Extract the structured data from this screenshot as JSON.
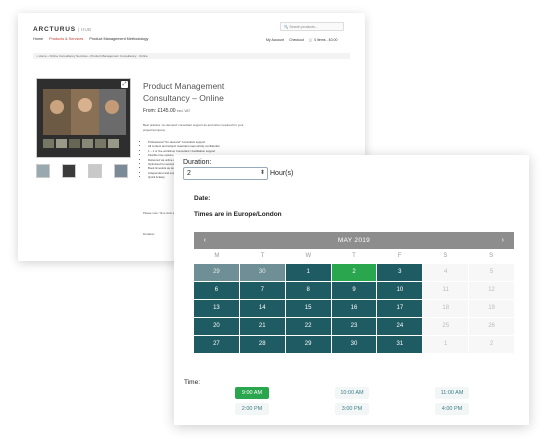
{
  "store": {
    "logo_text": "ARCTURUS",
    "logo_sub": "| HUB",
    "search_placeholder": "Search products...",
    "nav": [
      "Home",
      "Products & Services",
      "Product Management Methodology"
    ],
    "account": [
      "My Account",
      "Checkout",
      "0 items - £0.00"
    ],
    "breadcrumb": "Home › Online Consultancy Services › Product Management Consultancy - Online",
    "product_title": "Product Management Consultancy – Online",
    "price": "From: £145.00",
    "price_vat": "excl. VAT",
    "description": "Best practice 'on-demand' consultant support as and when required for your project/company.",
    "bullets": [
      "Professional \"On-demand\" Consultant support",
      "All content and subject material is kept strictly confidential",
      "1 – 1 or live workshop Consultant / Facilitation support",
      "Flexible time options",
      "Delivered via online conference",
      "Optimised for success",
      "Book timeslots as required",
      "Independent and expert Product Management",
      "Quick & Easy"
    ],
    "note": "Please note: Time slots are currently GMT",
    "duration_label": "Duration:"
  },
  "booking": {
    "duration_label": "Duration:",
    "duration_value": "2",
    "duration_unit": "Hour(s)",
    "date_label": "Date:",
    "timezone_label": "Times are in Europe/London",
    "time_label": "Time:"
  },
  "calendar": {
    "month": "MAY 2019",
    "prev": "‹",
    "next": "›",
    "dows": [
      "M",
      "T",
      "W",
      "T",
      "F",
      "S",
      "S"
    ],
    "days": [
      {
        "d": "29",
        "s": "muted"
      },
      {
        "d": "30",
        "s": "muted"
      },
      {
        "d": "1",
        "s": "avail"
      },
      {
        "d": "2",
        "s": "selected"
      },
      {
        "d": "3",
        "s": "avail"
      },
      {
        "d": "4",
        "s": "off"
      },
      {
        "d": "5",
        "s": "off"
      },
      {
        "d": "6",
        "s": "avail"
      },
      {
        "d": "7",
        "s": "avail"
      },
      {
        "d": "8",
        "s": "avail"
      },
      {
        "d": "9",
        "s": "avail"
      },
      {
        "d": "10",
        "s": "avail"
      },
      {
        "d": "11",
        "s": "off"
      },
      {
        "d": "12",
        "s": "off"
      },
      {
        "d": "13",
        "s": "avail"
      },
      {
        "d": "14",
        "s": "avail"
      },
      {
        "d": "15",
        "s": "avail"
      },
      {
        "d": "16",
        "s": "avail"
      },
      {
        "d": "17",
        "s": "avail"
      },
      {
        "d": "18",
        "s": "off"
      },
      {
        "d": "19",
        "s": "off"
      },
      {
        "d": "20",
        "s": "avail"
      },
      {
        "d": "21",
        "s": "avail"
      },
      {
        "d": "22",
        "s": "avail"
      },
      {
        "d": "23",
        "s": "avail"
      },
      {
        "d": "24",
        "s": "avail"
      },
      {
        "d": "25",
        "s": "off"
      },
      {
        "d": "26",
        "s": "off"
      },
      {
        "d": "27",
        "s": "avail"
      },
      {
        "d": "28",
        "s": "avail"
      },
      {
        "d": "29",
        "s": "avail"
      },
      {
        "d": "30",
        "s": "avail"
      },
      {
        "d": "31",
        "s": "avail"
      },
      {
        "d": "1",
        "s": "off"
      },
      {
        "d": "2",
        "s": "off"
      }
    ]
  },
  "times": [
    {
      "label": "9:00 AM",
      "selected": true
    },
    {
      "label": "10:00 AM",
      "selected": false
    },
    {
      "label": "11:00 AM",
      "selected": false
    },
    {
      "label": "2:00 PM",
      "selected": false
    },
    {
      "label": "3:00 PM",
      "selected": false
    },
    {
      "label": "4:00 PM",
      "selected": false
    }
  ],
  "colors": {
    "available": "#1f5b63",
    "past": "#6e8f95",
    "selected": "#2aa64f",
    "header": "#8d8d8d"
  }
}
